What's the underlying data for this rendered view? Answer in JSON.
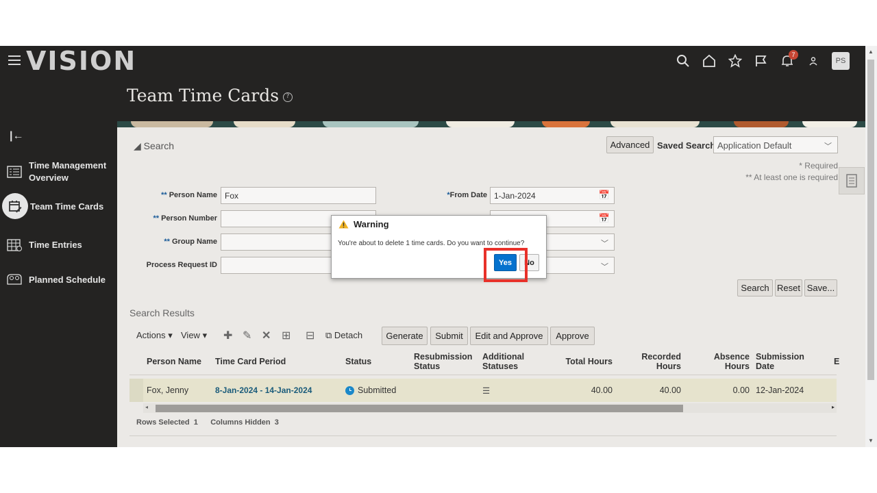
{
  "header": {
    "logo": "VISION",
    "notifications_count": "7",
    "avatar_initials": "PS"
  },
  "page": {
    "title": "Team Time Cards"
  },
  "sidebar": {
    "items": [
      {
        "label": "Time Management Overview"
      },
      {
        "label": "Team Time Cards"
      },
      {
        "label": "Time Entries"
      },
      {
        "label": "Planned Schedule"
      }
    ]
  },
  "search": {
    "toggle_label": "Search",
    "advanced_label": "Advanced",
    "saved_search_label": "Saved Search",
    "saved_search_value": "Application Default",
    "required_note": "* Required",
    "at_least_one_note": "** At least one is required",
    "fields": {
      "person_name_label": "Person Name",
      "person_name_value": "Fox",
      "person_number_label": "Person Number",
      "group_name_label": "Group Name",
      "process_request_label": "Process Request ID",
      "from_date_label": "From Date",
      "from_date_value": "1-Jan-2024"
    },
    "buttons": {
      "search": "Search",
      "reset": "Reset",
      "save": "Save..."
    }
  },
  "results": {
    "title": "Search Results",
    "toolbar": {
      "actions": "Actions",
      "view": "View",
      "detach": "Detach",
      "generate": "Generate",
      "submit": "Submit",
      "edit_and_approve": "Edit and Approve",
      "approve": "Approve"
    },
    "columns": {
      "person_name": "Person Name",
      "period": "Time Card Period",
      "status": "Status",
      "resubmission": "Resubmission Status",
      "additional": "Additional Statuses",
      "total_hours": "Total Hours",
      "recorded_hours": "Recorded Hours",
      "absence_hours": "Absence Hours",
      "submission_date": "Submission Date",
      "extra": "E"
    },
    "rows": [
      {
        "person_name": "Fox, Jenny",
        "period": "8-Jan-2024 - 14-Jan-2024",
        "status": "Submitted",
        "total_hours": "40.00",
        "recorded_hours": "40.00",
        "absence_hours": "0.00",
        "submission_date": "12-Jan-2024"
      }
    ],
    "rows_selected_label": "Rows Selected",
    "rows_selected_value": "1",
    "columns_hidden_label": "Columns Hidden",
    "columns_hidden_value": "3"
  },
  "dialog": {
    "title": "Warning",
    "message": "You're about to delete 1 time cards. Do you want to continue?",
    "yes": "Yes",
    "no": "No"
  },
  "colors": {
    "primary_button": "#0572ce",
    "highlight": "#e8312a",
    "app_background": "#242322"
  }
}
